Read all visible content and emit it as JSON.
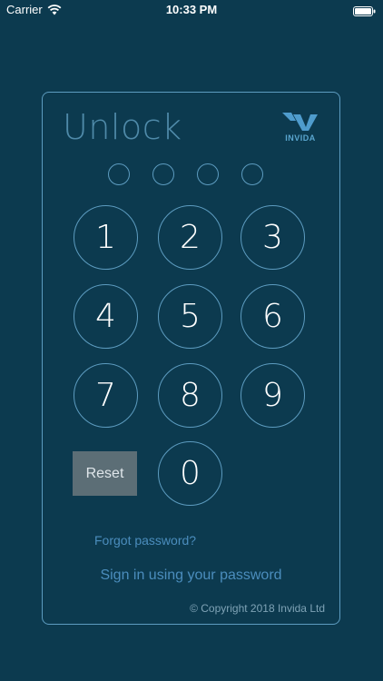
{
  "status_bar": {
    "carrier": "Carrier",
    "time": "10:33 PM",
    "wifi_icon": "wifi-icon",
    "battery_icon": "battery-icon"
  },
  "unlock": {
    "title": "Unlock",
    "logo_text": "INVIDA",
    "pin_dots_count": 4,
    "keys": [
      "1",
      "2",
      "3",
      "4",
      "5",
      "6",
      "7",
      "8",
      "9",
      "0"
    ],
    "reset_label": "Reset",
    "forgot_label": "Forgot password?",
    "signin_label": "Sign in using your password",
    "copyright": "© Copyright 2018 Invida Ltd"
  },
  "colors": {
    "background": "#0c3a4f",
    "accent": "#5d9cc0",
    "link": "#4b8dbd",
    "title": "#4f8aa9",
    "reset_bg": "#5c6e76"
  }
}
